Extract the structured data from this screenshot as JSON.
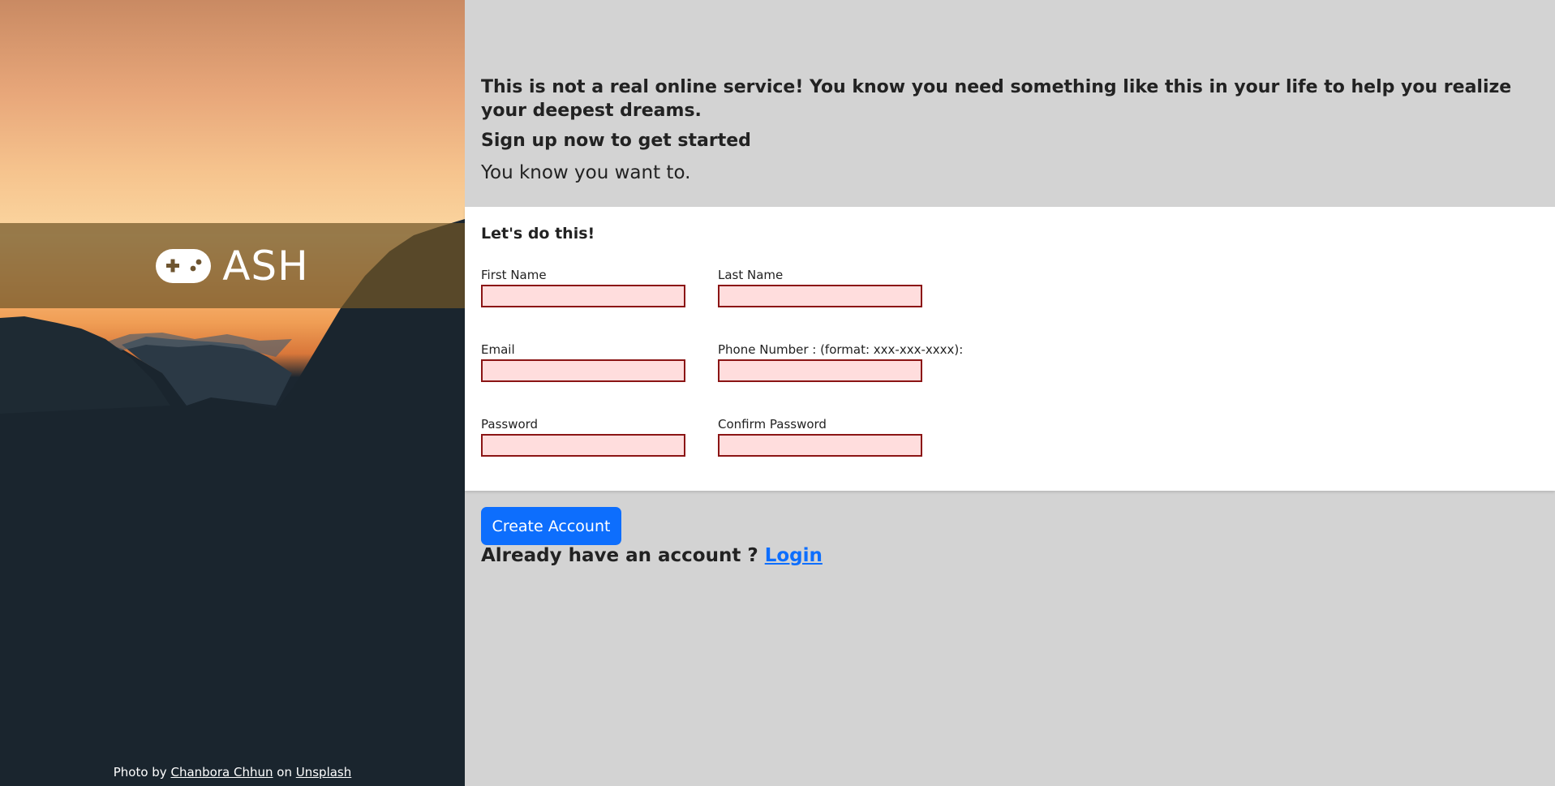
{
  "brand": {
    "name": "ASH",
    "icon": "gamepad-icon"
  },
  "credit": {
    "prefix": "Photo by",
    "author": "Chanbora Chhun",
    "middle": "on",
    "source": "Unsplash"
  },
  "intro": {
    "headline": "This is not a real online service! You know you need something like this in your life to help you realize your deepest dreams.",
    "subhead": "Sign up now to get started",
    "note": "You know you want to."
  },
  "form": {
    "title": "Let's do this!",
    "fields": {
      "first_name": {
        "label": "First Name",
        "value": ""
      },
      "last_name": {
        "label": "Last Name",
        "value": ""
      },
      "email": {
        "label": "Email",
        "value": ""
      },
      "phone": {
        "label": "Phone Number : (format: xxx-xxx-xxxx):",
        "value": ""
      },
      "password": {
        "label": "Password",
        "value": ""
      },
      "confirm_password": {
        "label": "Confirm Password",
        "value": ""
      }
    },
    "submit_label": "Create Account"
  },
  "login": {
    "prompt": "Already have an account ?",
    "link_label": "Login"
  },
  "colors": {
    "accent": "#0d6efd",
    "invalid_field_bg": "#ffdddd",
    "invalid_field_border": "#8b1515",
    "page_bg": "#d3d3d3"
  }
}
